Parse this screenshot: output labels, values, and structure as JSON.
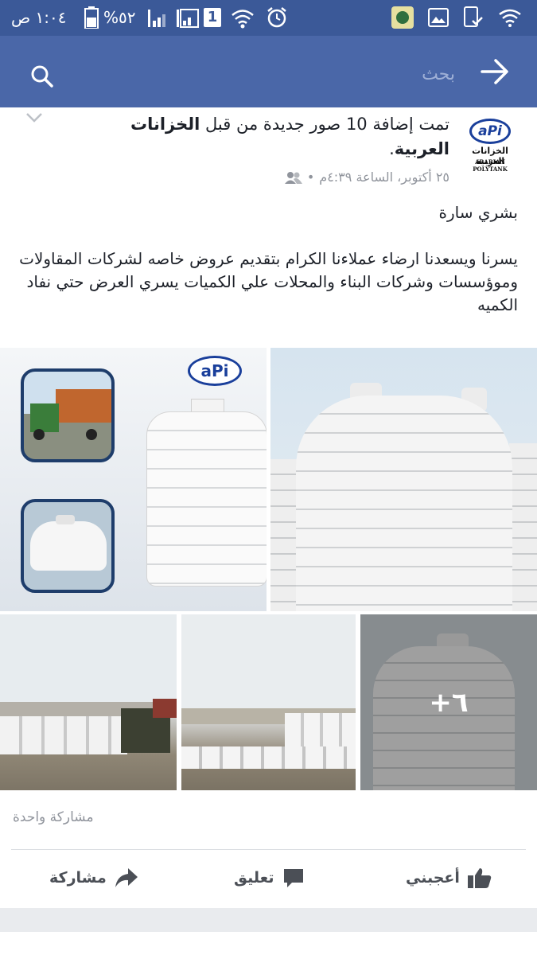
{
  "status_bar": {
    "time": "١:٠٤ ص",
    "battery": "%٥٢",
    "sim_number": "1"
  },
  "search": {
    "placeholder": "بحث"
  },
  "post": {
    "headline_prefix": "تمت إضافة 10 صور جديدة من قبل",
    "page_name": "الخزانات العربية",
    "headline_suffix": ".",
    "timestamp": "٢٥ أكتوبر، الساعة ٤:٣٩م",
    "timestamp_separator": "•",
    "text_line1": "بشري سارة",
    "text_body": "يسرنا ويسعدنا ارضاء عملاءنا الكرام بتقديم عروض خاصه لشركات المقاولات وموؤسسات وشركات البناء والمحلات علي  الكميات يسري العرض حتي نفاد الكميه",
    "logo": {
      "mark": "aPi",
      "arabic": "الخزانات العربية",
      "english": "ARABIAN POLYTANK"
    },
    "photo_badge": "aPi",
    "more_photos": "+٦",
    "shares_count": "مشاركة واحدة"
  },
  "actions": {
    "like": "أعجبني",
    "comment": "تعليق",
    "share": "مشاركة"
  },
  "icons": {
    "search": "search-icon",
    "back": "arrow-right-icon",
    "audience": "friends-icon",
    "like": "thumbs-up-icon",
    "comment": "comment-icon",
    "share": "share-arrow-icon"
  },
  "colors": {
    "facebook_blue": "#3b5998",
    "navbar_blue": "#4a67a8",
    "action_text": "#4b4f56",
    "meta_text": "#90949c"
  }
}
